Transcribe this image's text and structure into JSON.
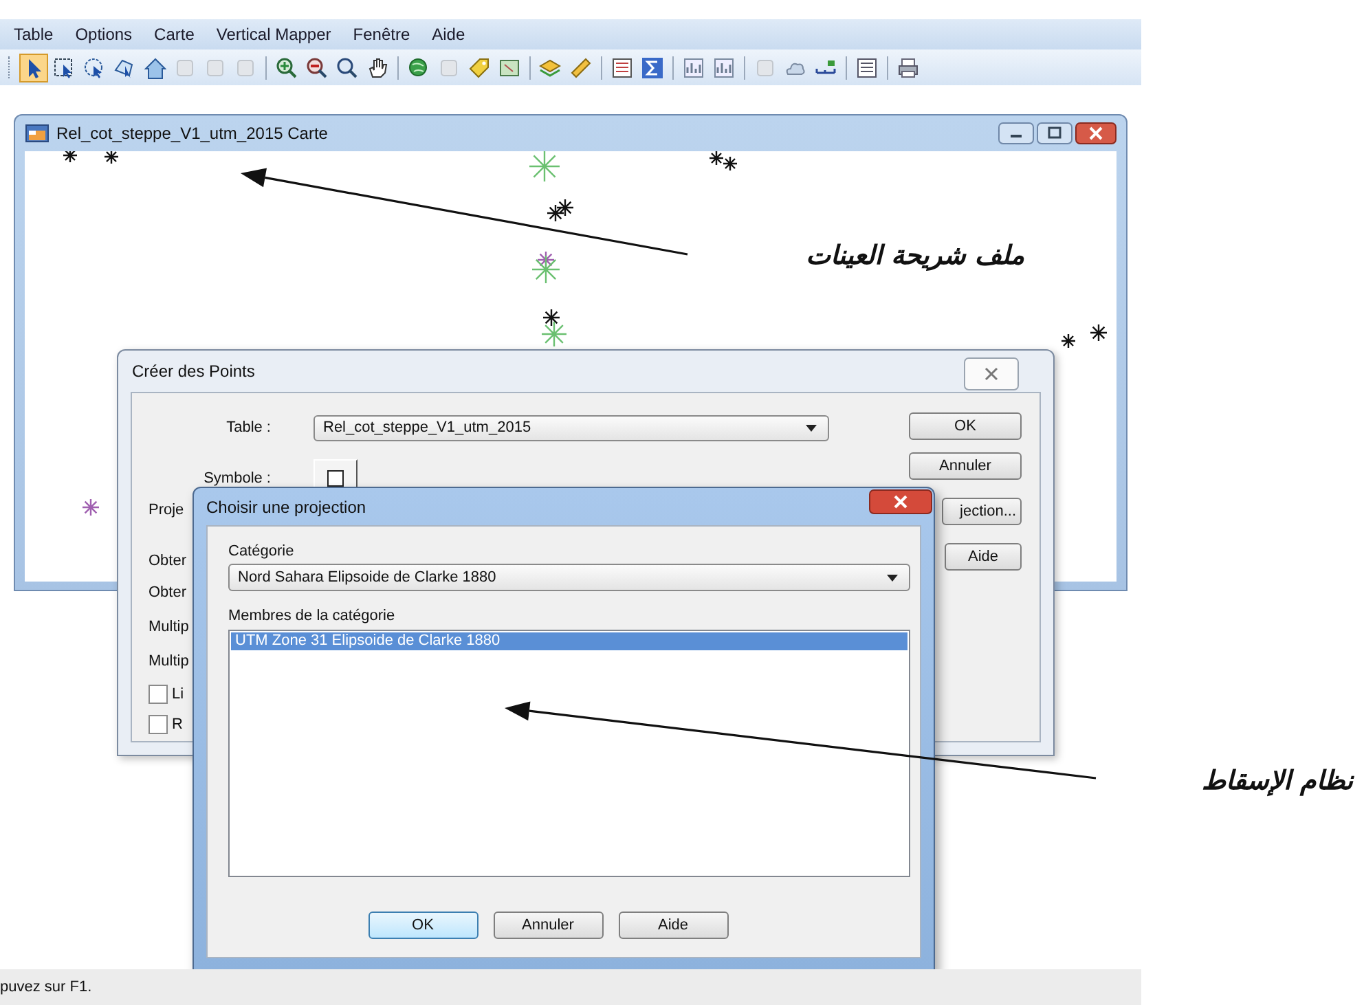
{
  "menu_bar": [
    "Table",
    "Options",
    "Carte",
    "Vertical Mapper",
    "Fenêtre",
    "Aide"
  ],
  "toolbar": {
    "tools": [
      {
        "kind": "pointer",
        "selected": true
      },
      {
        "kind": "marquee",
        "selected": false
      },
      {
        "kind": "radius",
        "selected": false
      },
      {
        "kind": "region",
        "selected": false
      },
      {
        "kind": "boundary",
        "selected": false
      },
      {
        "kind": "faint",
        "selected": false
      },
      {
        "kind": "faint",
        "selected": false
      },
      {
        "kind": "faint",
        "selected": false
      },
      {
        "kind": "separator"
      },
      {
        "kind": "zoom-in",
        "selected": false
      },
      {
        "kind": "zoom-out",
        "selected": false
      },
      {
        "kind": "zoom",
        "selected": false
      },
      {
        "kind": "hand",
        "selected": false
      },
      {
        "kind": "separator"
      },
      {
        "kind": "globe",
        "selected": false
      },
      {
        "kind": "faint",
        "selected": false
      },
      {
        "kind": "tag",
        "selected": false
      },
      {
        "kind": "map",
        "selected": false
      },
      {
        "kind": "separator"
      },
      {
        "kind": "layers",
        "selected": false
      },
      {
        "kind": "ruler",
        "selected": false
      },
      {
        "kind": "separator"
      },
      {
        "kind": "legend",
        "selected": false
      },
      {
        "kind": "sigma",
        "selected": false
      },
      {
        "kind": "separator"
      },
      {
        "kind": "graph",
        "selected": false
      },
      {
        "kind": "graph",
        "selected": false
      },
      {
        "kind": "separator"
      },
      {
        "kind": "faint",
        "selected": false
      },
      {
        "kind": "cloud",
        "selected": false
      },
      {
        "kind": "scale",
        "selected": false
      },
      {
        "kind": "separator"
      },
      {
        "kind": "list",
        "selected": false
      },
      {
        "kind": "separator"
      },
      {
        "kind": "printer",
        "selected": false
      }
    ]
  },
  "map_window": {
    "title": "Rel_cot_steppe_V1_utm_2015 Carte"
  },
  "create_points_dialog": {
    "title": "Créer des Points",
    "table_label": "Table :",
    "table_value": "Rel_cot_steppe_V1_utm_2015",
    "symbol_label": "Symbole :",
    "cut_labels": [
      "Proje",
      "Obter",
      "Obter",
      "Multip",
      "Multip"
    ],
    "checkboxes": [
      {
        "label": "Li",
        "checked": false
      },
      {
        "label": "R",
        "checked": false
      }
    ],
    "buttons": [
      "OK",
      "Annuler",
      "jection...",
      "Aide"
    ]
  },
  "projection_dialog": {
    "title": "Choisir une projection",
    "category_label": "Catégorie",
    "category_value": "Nord Sahara Elipsoide de Clarke 1880",
    "members_label": "Membres de la catégorie",
    "members": [
      {
        "label": "UTM Zone 31 Elipsoide de Clarke 1880",
        "selected": true
      }
    ],
    "buttons": [
      {
        "label": "OK",
        "default": true
      },
      {
        "label": "Annuler",
        "default": false
      },
      {
        "label": "Aide",
        "default": false
      }
    ]
  },
  "annotations": [
    {
      "text": "ملف شريحة العينات"
    },
    {
      "text": "نظام الإسقاط"
    }
  ],
  "status_bar": {
    "text": "puvez sur F1."
  }
}
